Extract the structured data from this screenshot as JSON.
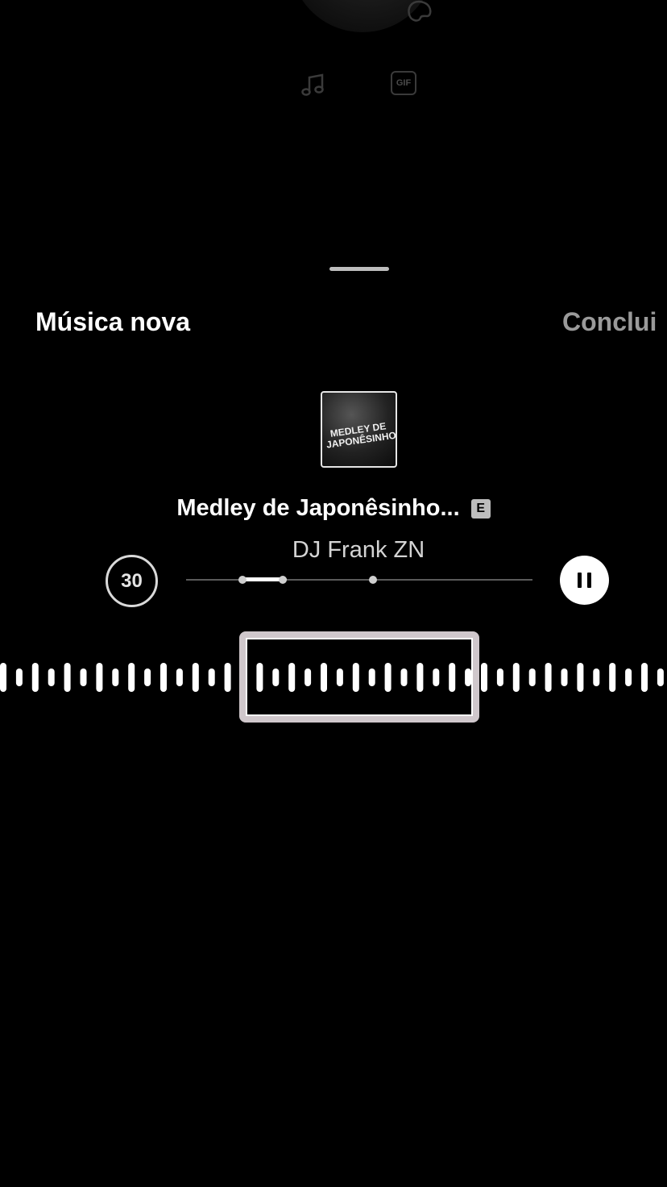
{
  "background": {
    "gif_label": "GIF"
  },
  "sheet": {
    "title": "Música nova",
    "done_label": "Conclui"
  },
  "track": {
    "album_art_text": "Medley de Japonêsinho",
    "title": "Medley de Japonêsinho...",
    "explicit_badge": "E",
    "artist": "DJ Frank ZN"
  },
  "controls": {
    "duration": "30",
    "selection_start_fraction": 0.16,
    "selection_end_fraction": 0.29,
    "marker_fraction": 0.54
  },
  "colors": {
    "background": "#000000",
    "text": "#ffffff",
    "done_label": "#9a9a9a",
    "selection_frame": "#cfc7cb"
  },
  "icons": {
    "palette": "palette-icon",
    "music": "music-note-icon",
    "gif": "gif-icon",
    "pause": "pause-icon"
  }
}
